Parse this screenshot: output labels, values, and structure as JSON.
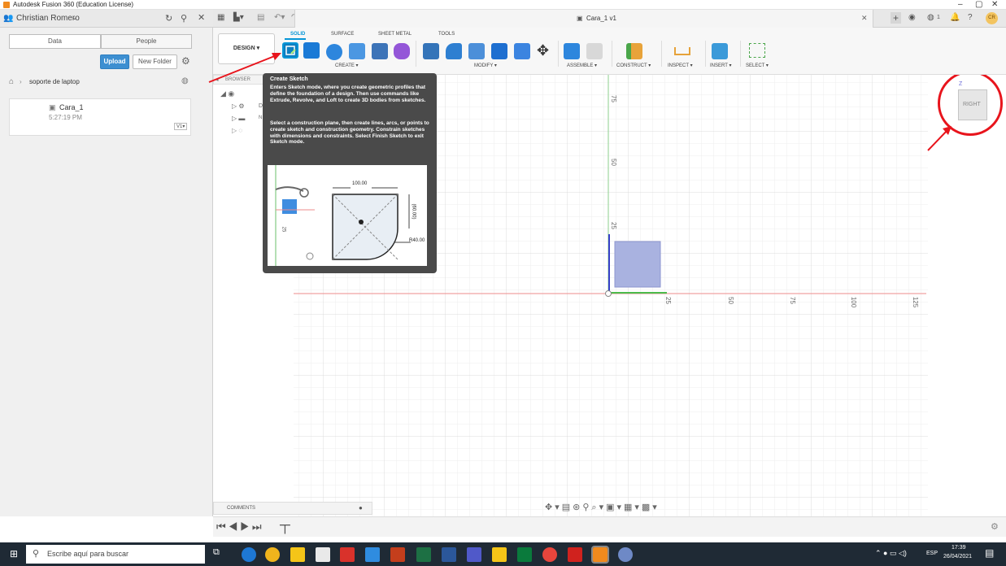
{
  "window": {
    "title": "Autodesk Fusion 360 (Education License)",
    "minimize": "–",
    "maximize": "▢",
    "close": "✕"
  },
  "data_panel": {
    "user": "Christian Romero",
    "tab_data": "Data",
    "tab_people": "People",
    "upload": "Upload",
    "new_folder": "New Folder",
    "breadcrumb": "soporte de laptop",
    "file_name": "Cara_1",
    "file_time": "5:27:19 PM",
    "file_version": "V1▾"
  },
  "doc_tab": {
    "title": "Cara_1 v1",
    "notif_count": "1",
    "avatar": "CR"
  },
  "workspace": {
    "label": "DESIGN ▾"
  },
  "ribbon_tabs": [
    "SOLID",
    "SURFACE",
    "SHEET METAL",
    "TOOLS"
  ],
  "ribbon_groups": [
    "CREATE ▾",
    "MODIFY ▾",
    "ASSEMBLE ▾",
    "CONSTRUCT ▾",
    "INSPECT ▾",
    "INSERT ▾",
    "SELECT ▾"
  ],
  "browser": {
    "header": "BROWSER",
    "comments": "COMMENTS",
    "items": [
      "D",
      "N"
    ]
  },
  "tooltip": {
    "title": "Create Sketch",
    "p1": "Enters Sketch mode, where you create geometric profiles that define the foundation of a design. Then use commands like Extrude, Revolve, and Loft to create 3D bodies from sketches.",
    "p2": "Select a construction plane, then create lines, arcs, or points to create sketch and construction geometry. Constrain sketches with dimensions and constraints. Select Finish Sketch to exit Sketch mode.",
    "dim_width": "100.00",
    "dim_height": "(60.00)",
    "dim_radius": "R40.00",
    "dim_side": "25"
  },
  "viewcube": {
    "face": "RIGHT",
    "axis_z": "Z"
  },
  "axis_ticks": {
    "vertical": [
      "75",
      "50",
      "25"
    ],
    "horizontal": [
      "25",
      "50",
      "75",
      "100",
      "125"
    ]
  },
  "taskbar": {
    "search_placeholder": "Escribe aquí para buscar",
    "lang": "ESP",
    "time": "17:39",
    "date": "26/04/2021"
  },
  "colors": {
    "accent": "#0696d7",
    "sketch_fill": "#a9b2e0",
    "red_annotation": "#e8141c",
    "tooltip_bg": "#4a4a4a"
  }
}
